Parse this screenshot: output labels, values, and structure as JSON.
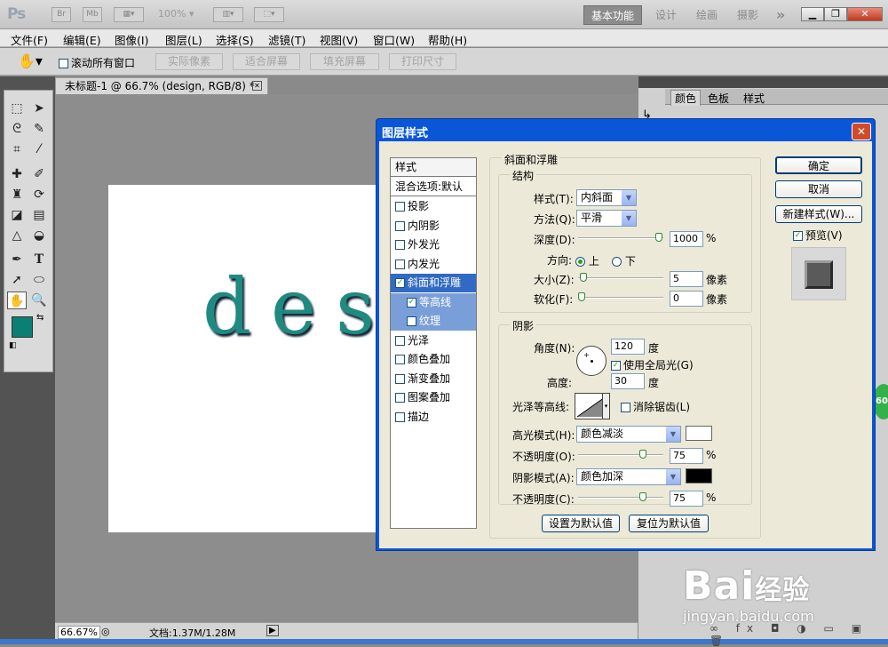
{
  "app": {
    "logo": "Ps",
    "bridge_label": "Br",
    "minibridge_label": "Mb",
    "zoom": "100%",
    "workspaces": [
      "基本功能",
      "设计",
      "绘画",
      "摄影"
    ],
    "more": "»"
  },
  "menu": [
    "文件(F)",
    "编辑(E)",
    "图像(I)",
    "图层(L)",
    "选择(S)",
    "滤镜(T)",
    "视图(V)",
    "窗口(W)",
    "帮助(H)"
  ],
  "options": {
    "scroll_all": "滚动所有窗口",
    "buttons": [
      "实际像素",
      "适合屏幕",
      "填充屏幕",
      "打印尺寸"
    ]
  },
  "document": {
    "tab_title": "未标题-1 @ 66.7% (design, RGB/8) *",
    "canvas_text": "desi",
    "zoom": "66.67%",
    "doc_size": "文档:1.37M/1.28M"
  },
  "panels": {
    "tabs": [
      "颜色",
      "色板",
      "样式"
    ]
  },
  "dialog": {
    "title": "图层样式",
    "style_list": [
      {
        "label": "样式",
        "checkbox": false,
        "checked": false,
        "state": "header"
      },
      {
        "label": "混合选项:默认",
        "checkbox": false,
        "checked": false,
        "state": "normal"
      },
      {
        "label": "投影",
        "checkbox": true,
        "checked": false,
        "state": "normal"
      },
      {
        "label": "内阴影",
        "checkbox": true,
        "checked": false,
        "state": "normal"
      },
      {
        "label": "外发光",
        "checkbox": true,
        "checked": false,
        "state": "normal"
      },
      {
        "label": "内发光",
        "checkbox": true,
        "checked": false,
        "state": "normal"
      },
      {
        "label": "斜面和浮雕",
        "checkbox": true,
        "checked": true,
        "state": "selected"
      },
      {
        "label": "等高线",
        "checkbox": true,
        "checked": true,
        "state": "sub"
      },
      {
        "label": "纹理",
        "checkbox": true,
        "checked": false,
        "state": "sub"
      },
      {
        "label": "光泽",
        "checkbox": true,
        "checked": false,
        "state": "normal"
      },
      {
        "label": "颜色叠加",
        "checkbox": true,
        "checked": false,
        "state": "normal"
      },
      {
        "label": "渐变叠加",
        "checkbox": true,
        "checked": false,
        "state": "normal"
      },
      {
        "label": "图案叠加",
        "checkbox": true,
        "checked": false,
        "state": "normal"
      },
      {
        "label": "描边",
        "checkbox": true,
        "checked": false,
        "state": "normal"
      }
    ],
    "bevel": {
      "section_title": "斜面和浮雕",
      "structure": {
        "title": "结构",
        "style_label": "样式(T):",
        "style_value": "内斜面",
        "technique_label": "方法(Q):",
        "technique_value": "平滑",
        "depth_label": "深度(D):",
        "depth_value": "1000",
        "depth_unit": "%",
        "depth_fraction": 0.95,
        "direction_label": "方向:",
        "direction_up": "上",
        "direction_down": "下",
        "direction_selected": "上",
        "size_label": "大小(Z):",
        "size_value": "5",
        "size_unit": "像素",
        "size_fraction": 0.02,
        "soften_label": "软化(F):",
        "soften_value": "0",
        "soften_unit": "像素",
        "soften_fraction": 0.0
      },
      "shading": {
        "title": "阴影",
        "angle_label": "角度(N):",
        "angle_value": "120",
        "angle_unit": "度",
        "global_light_label": "使用全局光(G)",
        "global_light_checked": true,
        "altitude_label": "高度:",
        "altitude_value": "30",
        "altitude_unit": "度",
        "gloss_contour_label": "光泽等高线:",
        "anti_aliased_label": "消除锯齿(L)",
        "anti_aliased_checked": false,
        "highlight_mode_label": "高光模式(H):",
        "highlight_mode_value": "颜色减淡",
        "highlight_color": "#ffffff",
        "highlight_opacity_label": "不透明度(O):",
        "highlight_opacity_value": "75",
        "highlight_opacity_fraction": 0.75,
        "shadow_mode_label": "阴影模式(A):",
        "shadow_mode_value": "颜色加深",
        "shadow_color": "#000000",
        "shadow_opacity_label": "不透明度(C):",
        "shadow_opacity_value": "75",
        "shadow_opacity_fraction": 0.75,
        "percent": "%"
      },
      "make_default": "设置为默认值",
      "reset_default": "复位为默认值"
    },
    "ok": "确定",
    "cancel": "取消",
    "new_style": "新建样式(W)...",
    "preview_label": "预览(V)",
    "preview_checked": true
  },
  "watermark": {
    "brand": "Bai",
    "brand2": "经验",
    "url": "jingyan.baidu.com"
  },
  "badge": "60",
  "colors": {
    "foreground": "#0b7f73",
    "background": "#9ccc9c",
    "dialog_frame": "#0a56d8",
    "selected_row": "#316ac5",
    "sub_row": "#7a9fd8"
  }
}
